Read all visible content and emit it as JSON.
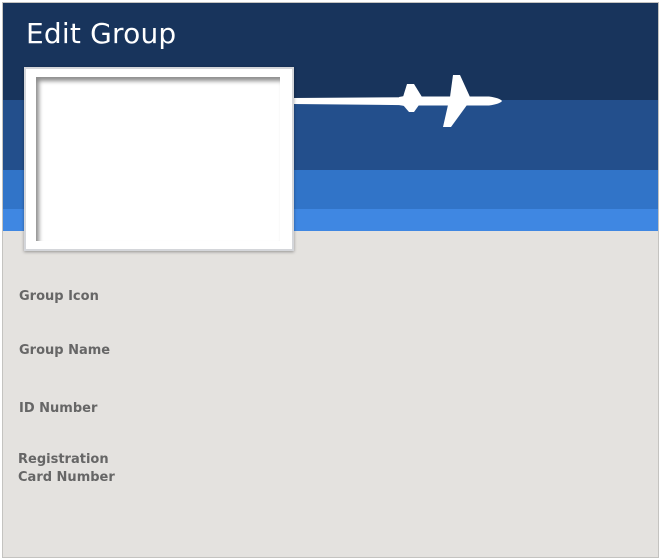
{
  "window": {
    "title": "Edit Group"
  },
  "header": {
    "image": "airplane-icon",
    "colors": {
      "band_dark": "#18345c",
      "band_mid": "#234f8c",
      "band_light": "#3174c8",
      "band_bright": "#3f87e2",
      "content_background": "#e4e2df"
    }
  },
  "form": {
    "group_icon_label": "Group Icon",
    "group_name_label": "Group Name",
    "id_number_label": "ID Number",
    "registration_card_label_line1": "Registration",
    "registration_card_label_line2": "Card Number"
  }
}
